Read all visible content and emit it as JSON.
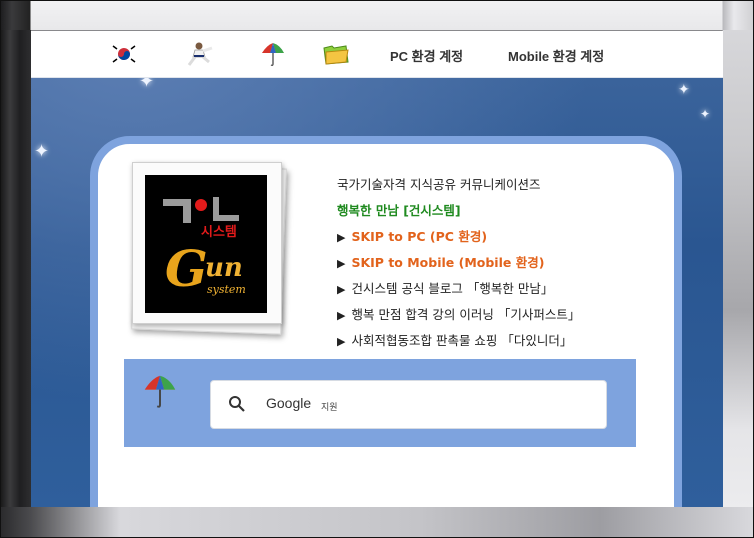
{
  "topnav": {
    "icons": [
      "korea-flag-icon",
      "martial-arts-icon",
      "umbrella-icon",
      "folder-icon"
    ],
    "pc_link": "PC 환경 계정",
    "mobile_link": "Mobile 환경 계정"
  },
  "logo": {
    "korean": "시스템",
    "brand_letter": "G",
    "brand_rest": "un",
    "system": "system"
  },
  "links": {
    "subtitle": "국가기술자격 지식공유 커뮤니케이션즈",
    "brand_line": "행복한 만남 [건시스템]",
    "arrow": "▶",
    "skip_pc": "SKIP to PC (PC 환경)",
    "skip_mobile": "SKIP to Mobile (Mobile 환경)",
    "blog": "건시스템 공식 블로그 「행복한 만남」",
    "elearning": "행복 만점 합격 강의 이러닝 「기사퍼스트」",
    "shop": "사회적협동조합 판촉물 쇼핑 「다있니더」"
  },
  "search": {
    "brand": "Google",
    "label": "지원"
  },
  "colors": {
    "card_border": "#7ea3de",
    "green": "#1f8a1f",
    "orange": "#e2631c",
    "page_blue": "#2a5691"
  }
}
